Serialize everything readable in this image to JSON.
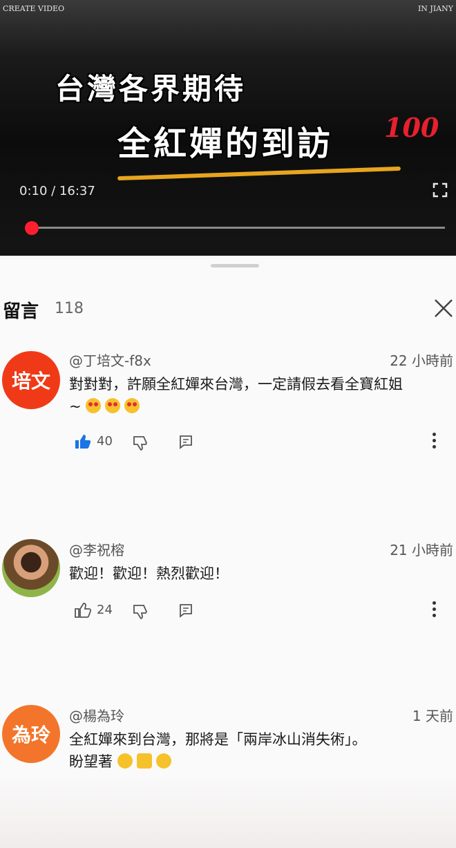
{
  "watermark": {
    "left": "CREATE VIDEO",
    "right": "IN JIANY"
  },
  "video": {
    "title_line1": "台灣各界期待",
    "title_line2": "全紅嬋的到訪",
    "emoji_badge": "100",
    "time": "0:10 / 16:37",
    "progress_fraction": 0.01
  },
  "comments_sheet": {
    "title": "留言",
    "count": "118",
    "comments": [
      {
        "avatar_text": "培文",
        "avatar_color": "#f03a17",
        "handle": "@丁培文-f8x",
        "time": "22 小時前",
        "text": "對對對，許願全紅嬋來台灣，一定請假去看全寶紅姐",
        "text2": "~",
        "likes": "40",
        "liked": true
      },
      {
        "avatar_text": "",
        "avatar_color": "#c28a52",
        "handle": "@李祝榕",
        "time": "21 小時前",
        "text": "歡迎！歡迎！熱烈歡迎！",
        "text2": "",
        "likes": "24",
        "liked": false
      },
      {
        "avatar_text": "為玲",
        "avatar_color": "#f3752b",
        "handle": "@楊為玲",
        "time": "1 天前",
        "text": "全紅嬋來到台灣，那將是「兩岸冰山消失術」。",
        "text2": "盼望著",
        "likes": "",
        "liked": false
      }
    ]
  }
}
